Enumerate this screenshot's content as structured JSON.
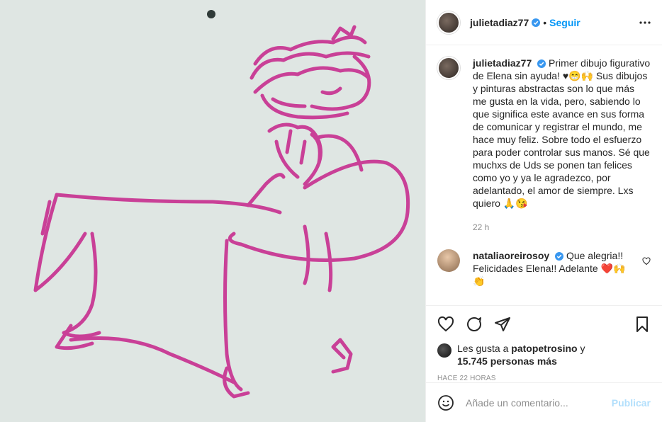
{
  "post": {
    "username": "julietadiaz77",
    "follow_label": "Seguir",
    "caption": "Primer dibujo figurativo de Elena sin ayuda! ♥😁🙌 Sus dibujos y pinturas abstractas son lo que más me gusta en la vida, pero, sabiendo lo que significa este avance en sus forma de comunicar y registrar el mundo, me hace muy feliz. Sobre todo el esfuerzo para poder controlar sus manos. Sé que muchxs de Uds se ponen tan felices como yo y ya le agradezco, por adelantado, el amor de siempre. Lxs quiero 🙏😘",
    "caption_time": "22 h"
  },
  "comments": [
    {
      "username": "nataliaoreirosoy",
      "text": "Que alegria!! Felicidades Elena!! Adelante ❤️🙌👏"
    }
  ],
  "likes": {
    "prefix": "Les gusta a",
    "first_user": "patopetrosino",
    "connector": "y",
    "others": "15.745 personas más"
  },
  "timestamp": "HACE 22 HORAS",
  "add_comment": {
    "placeholder": "Añade un comentario...",
    "publish_label": "Publicar"
  },
  "icons": [
    "verified-icon",
    "more-icon",
    "heart-icon",
    "comment-icon",
    "share-icon",
    "bookmark-icon",
    "emoji-icon"
  ],
  "colors": {
    "link": "#0095f6",
    "publish_disabled": "#b2dffc",
    "drawing_ink": "#c72f8f",
    "paper": "#dfe6e3"
  }
}
